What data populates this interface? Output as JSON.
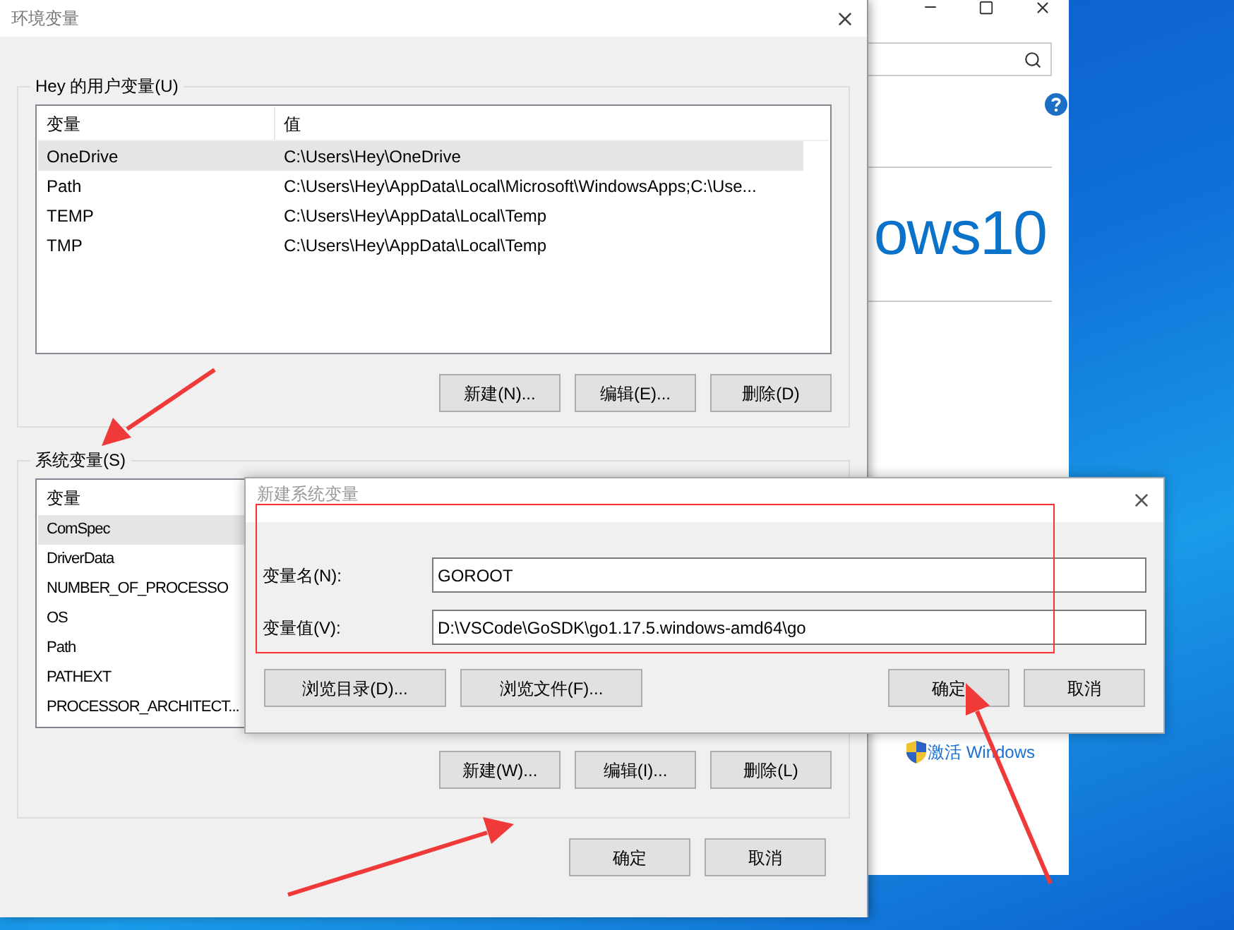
{
  "background_window": {
    "logo_text": "ows10",
    "activation_link": "激活 Windows"
  },
  "env_dialog": {
    "title": "环境变量",
    "user_group": {
      "title": "Hey 的用户变量(U)",
      "columns": [
        "变量",
        "值"
      ],
      "rows": [
        {
          "name": "OneDrive",
          "value": "C:\\Users\\Hey\\OneDrive",
          "selected": true
        },
        {
          "name": "Path",
          "value": "C:\\Users\\Hey\\AppData\\Local\\Microsoft\\WindowsApps;C:\\Use...",
          "selected": false
        },
        {
          "name": "TEMP",
          "value": "C:\\Users\\Hey\\AppData\\Local\\Temp",
          "selected": false
        },
        {
          "name": "TMP",
          "value": "C:\\Users\\Hey\\AppData\\Local\\Temp",
          "selected": false
        }
      ],
      "buttons": [
        "新建(N)...",
        "编辑(E)...",
        "删除(D)"
      ]
    },
    "system_group": {
      "title": "系统变量(S)",
      "columns": [
        "变量"
      ],
      "rows": [
        {
          "name": "ComSpec",
          "selected": true
        },
        {
          "name": "DriverData",
          "selected": false
        },
        {
          "name": "NUMBER_OF_PROCESSO",
          "selected": false
        },
        {
          "name": "OS",
          "selected": false
        },
        {
          "name": "Path",
          "selected": false
        },
        {
          "name": "PATHEXT",
          "selected": false
        },
        {
          "name": "PROCESSOR_ARCHITECT...",
          "selected": false
        }
      ],
      "buttons": [
        "新建(W)...",
        "编辑(I)...",
        "删除(L)"
      ]
    },
    "buttons": [
      "确定",
      "取消"
    ]
  },
  "new_var_dialog": {
    "title": "新建系统变量",
    "fields": [
      {
        "label": "变量名(N):",
        "value": "GOROOT"
      },
      {
        "label": "变量值(V):",
        "value": "D:\\VSCode\\GoSDK\\go1.17.5.windows-amd64\\go"
      }
    ],
    "browse_buttons": [
      "浏览目录(D)...",
      "浏览文件(F)..."
    ],
    "buttons": [
      "确定",
      "取消"
    ]
  }
}
